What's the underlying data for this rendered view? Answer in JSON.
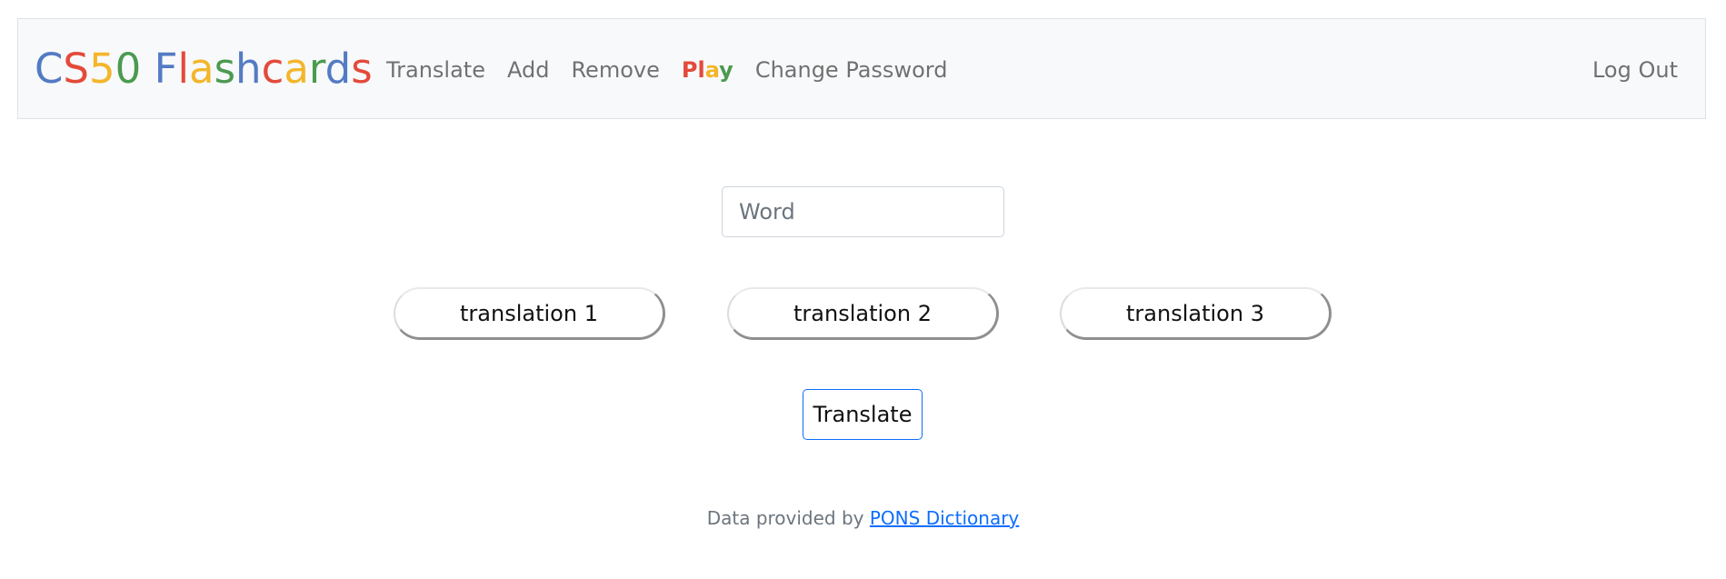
{
  "navbar": {
    "brand": {
      "letters": [
        {
          "char": "C",
          "color": "#537bc4"
        },
        {
          "char": "S",
          "color": "#e34a3a"
        },
        {
          "char": "5",
          "color": "#f3b62b"
        },
        {
          "char": "0",
          "color": "#4b9a50"
        },
        {
          "char": " ",
          "color": "#537bc4"
        },
        {
          "char": "F",
          "color": "#537bc4"
        },
        {
          "char": "l",
          "color": "#e34a3a"
        },
        {
          "char": "a",
          "color": "#f3b62b"
        },
        {
          "char": "s",
          "color": "#4b9a50"
        },
        {
          "char": "h",
          "color": "#537bc4"
        },
        {
          "char": "c",
          "color": "#e34a3a"
        },
        {
          "char": "a",
          "color": "#f3b62b"
        },
        {
          "char": "r",
          "color": "#4b9a50"
        },
        {
          "char": "d",
          "color": "#537bc4"
        },
        {
          "char": "s",
          "color": "#e34a3a"
        }
      ]
    },
    "links": {
      "translate": "Translate",
      "add": "Add",
      "remove": "Remove",
      "play": [
        {
          "char": "P",
          "color": "#e34a3a"
        },
        {
          "char": "l",
          "color": "#e34a3a"
        },
        {
          "char": "a",
          "color": "#f3b62b"
        },
        {
          "char": "y",
          "color": "#4b9a50"
        }
      ],
      "change_password": "Change Password"
    },
    "logout": "Log Out"
  },
  "form": {
    "word_placeholder": "Word",
    "word_value": "",
    "translations": [
      "translation 1",
      "translation 2",
      "translation 3"
    ],
    "submit_label": "Translate"
  },
  "footer": {
    "prefix": "Data provided by ",
    "link_text": "PONS Dictionary"
  },
  "colors": {
    "navbar_bg": "#f8f9fa",
    "link_blue": "#0d6efd"
  }
}
